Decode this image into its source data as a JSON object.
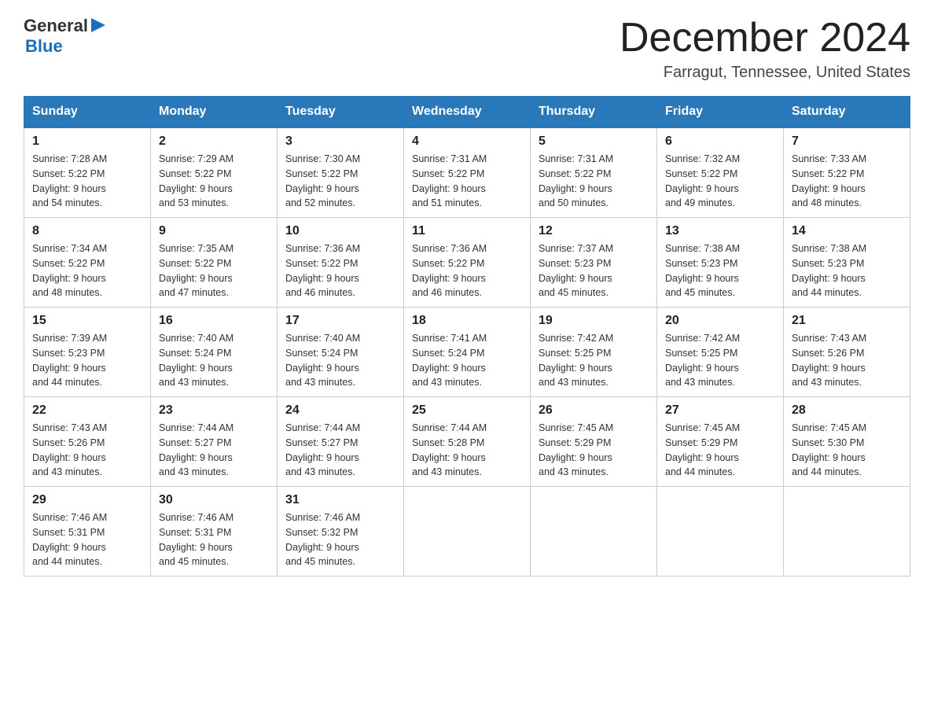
{
  "header": {
    "logo": {
      "general": "General",
      "arrow": "▶",
      "blue": "Blue"
    },
    "title": "December 2024",
    "location": "Farragut, Tennessee, United States"
  },
  "days_of_week": [
    "Sunday",
    "Monday",
    "Tuesday",
    "Wednesday",
    "Thursday",
    "Friday",
    "Saturday"
  ],
  "weeks": [
    [
      {
        "day": "1",
        "sunrise": "7:28 AM",
        "sunset": "5:22 PM",
        "daylight": "9 hours and 54 minutes."
      },
      {
        "day": "2",
        "sunrise": "7:29 AM",
        "sunset": "5:22 PM",
        "daylight": "9 hours and 53 minutes."
      },
      {
        "day": "3",
        "sunrise": "7:30 AM",
        "sunset": "5:22 PM",
        "daylight": "9 hours and 52 minutes."
      },
      {
        "day": "4",
        "sunrise": "7:31 AM",
        "sunset": "5:22 PM",
        "daylight": "9 hours and 51 minutes."
      },
      {
        "day": "5",
        "sunrise": "7:31 AM",
        "sunset": "5:22 PM",
        "daylight": "9 hours and 50 minutes."
      },
      {
        "day": "6",
        "sunrise": "7:32 AM",
        "sunset": "5:22 PM",
        "daylight": "9 hours and 49 minutes."
      },
      {
        "day": "7",
        "sunrise": "7:33 AM",
        "sunset": "5:22 PM",
        "daylight": "9 hours and 48 minutes."
      }
    ],
    [
      {
        "day": "8",
        "sunrise": "7:34 AM",
        "sunset": "5:22 PM",
        "daylight": "9 hours and 48 minutes."
      },
      {
        "day": "9",
        "sunrise": "7:35 AM",
        "sunset": "5:22 PM",
        "daylight": "9 hours and 47 minutes."
      },
      {
        "day": "10",
        "sunrise": "7:36 AM",
        "sunset": "5:22 PM",
        "daylight": "9 hours and 46 minutes."
      },
      {
        "day": "11",
        "sunrise": "7:36 AM",
        "sunset": "5:22 PM",
        "daylight": "9 hours and 46 minutes."
      },
      {
        "day": "12",
        "sunrise": "7:37 AM",
        "sunset": "5:23 PM",
        "daylight": "9 hours and 45 minutes."
      },
      {
        "day": "13",
        "sunrise": "7:38 AM",
        "sunset": "5:23 PM",
        "daylight": "9 hours and 45 minutes."
      },
      {
        "day": "14",
        "sunrise": "7:38 AM",
        "sunset": "5:23 PM",
        "daylight": "9 hours and 44 minutes."
      }
    ],
    [
      {
        "day": "15",
        "sunrise": "7:39 AM",
        "sunset": "5:23 PM",
        "daylight": "9 hours and 44 minutes."
      },
      {
        "day": "16",
        "sunrise": "7:40 AM",
        "sunset": "5:24 PM",
        "daylight": "9 hours and 43 minutes."
      },
      {
        "day": "17",
        "sunrise": "7:40 AM",
        "sunset": "5:24 PM",
        "daylight": "9 hours and 43 minutes."
      },
      {
        "day": "18",
        "sunrise": "7:41 AM",
        "sunset": "5:24 PM",
        "daylight": "9 hours and 43 minutes."
      },
      {
        "day": "19",
        "sunrise": "7:42 AM",
        "sunset": "5:25 PM",
        "daylight": "9 hours and 43 minutes."
      },
      {
        "day": "20",
        "sunrise": "7:42 AM",
        "sunset": "5:25 PM",
        "daylight": "9 hours and 43 minutes."
      },
      {
        "day": "21",
        "sunrise": "7:43 AM",
        "sunset": "5:26 PM",
        "daylight": "9 hours and 43 minutes."
      }
    ],
    [
      {
        "day": "22",
        "sunrise": "7:43 AM",
        "sunset": "5:26 PM",
        "daylight": "9 hours and 43 minutes."
      },
      {
        "day": "23",
        "sunrise": "7:44 AM",
        "sunset": "5:27 PM",
        "daylight": "9 hours and 43 minutes."
      },
      {
        "day": "24",
        "sunrise": "7:44 AM",
        "sunset": "5:27 PM",
        "daylight": "9 hours and 43 minutes."
      },
      {
        "day": "25",
        "sunrise": "7:44 AM",
        "sunset": "5:28 PM",
        "daylight": "9 hours and 43 minutes."
      },
      {
        "day": "26",
        "sunrise": "7:45 AM",
        "sunset": "5:29 PM",
        "daylight": "9 hours and 43 minutes."
      },
      {
        "day": "27",
        "sunrise": "7:45 AM",
        "sunset": "5:29 PM",
        "daylight": "9 hours and 44 minutes."
      },
      {
        "day": "28",
        "sunrise": "7:45 AM",
        "sunset": "5:30 PM",
        "daylight": "9 hours and 44 minutes."
      }
    ],
    [
      {
        "day": "29",
        "sunrise": "7:46 AM",
        "sunset": "5:31 PM",
        "daylight": "9 hours and 44 minutes."
      },
      {
        "day": "30",
        "sunrise": "7:46 AM",
        "sunset": "5:31 PM",
        "daylight": "9 hours and 45 minutes."
      },
      {
        "day": "31",
        "sunrise": "7:46 AM",
        "sunset": "5:32 PM",
        "daylight": "9 hours and 45 minutes."
      },
      null,
      null,
      null,
      null
    ]
  ],
  "labels": {
    "sunrise": "Sunrise:",
    "sunset": "Sunset:",
    "daylight": "Daylight:"
  }
}
